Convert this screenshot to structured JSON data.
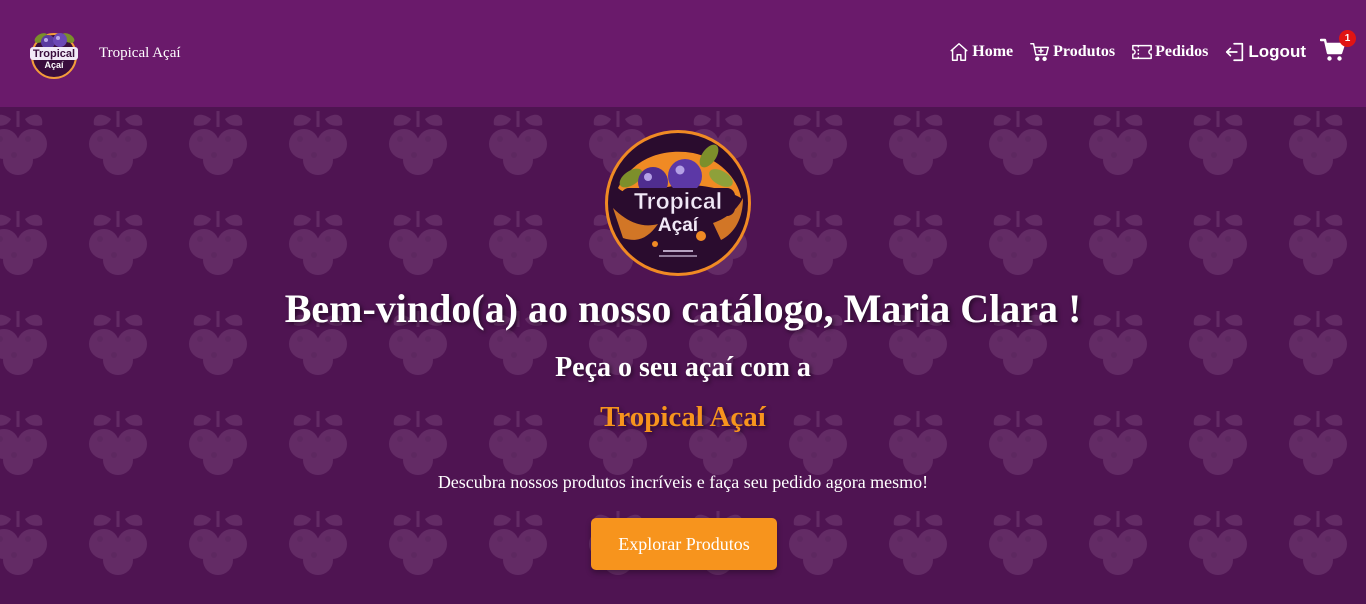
{
  "navbar": {
    "brand_name": "Tropical Açaí",
    "logo_line1": "Tropical",
    "logo_line2": "Açaí",
    "links": [
      {
        "label": "Home",
        "icon": "home-icon"
      },
      {
        "label": "Produtos",
        "icon": "cart-plus-icon"
      },
      {
        "label": "Pedidos",
        "icon": "ticket-icon"
      },
      {
        "label": "Logout",
        "icon": "logout-icon"
      }
    ],
    "cart": {
      "icon": "cart-icon",
      "count": "1"
    }
  },
  "hero": {
    "logo_line1": "Tropical",
    "logo_line2": "Açaí",
    "title": "Bem-vindo(a) ao nosso catálogo, Maria Clara !",
    "subtitle": "Peça o seu açaí com a",
    "brand": "Tropical Açaí",
    "description": "Descubra nossos produtos incríveis e faça seu pedido agora mesmo!",
    "cta_label": "Explorar Produtos"
  },
  "colors": {
    "navbar_bg": "#6a1a6b",
    "hero_bg": "#4f1452",
    "accent_orange": "#f7941d",
    "badge_red": "#e01414"
  }
}
